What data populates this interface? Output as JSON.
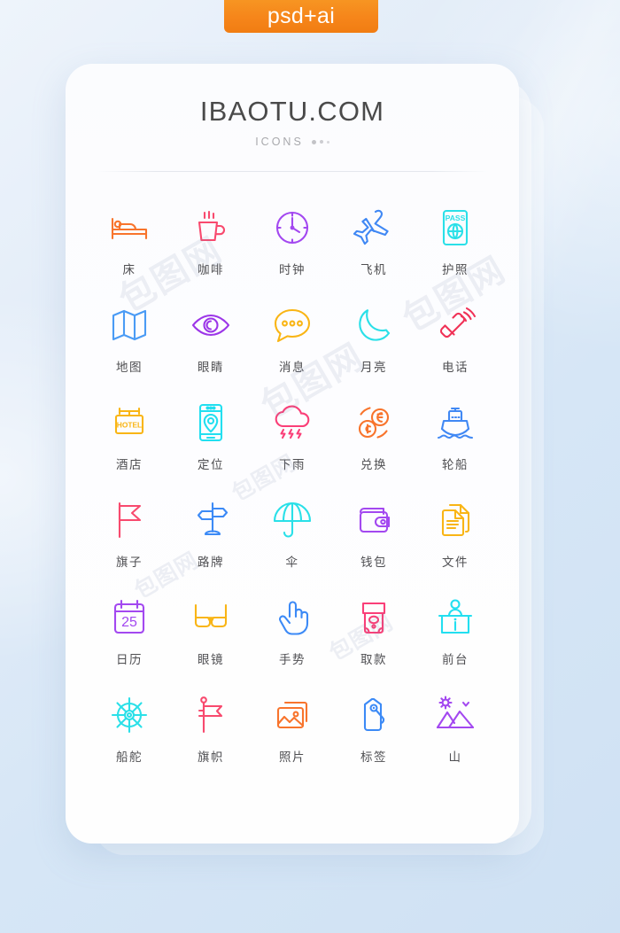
{
  "badge": {
    "label": "psd+ai",
    "color": "#f6851a"
  },
  "card": {
    "title": "IBAOTU.COM",
    "subtitle": "ICONS"
  },
  "watermark": {
    "text": "包图网"
  },
  "icons": [
    {
      "name": "bed",
      "label": "床",
      "color": "#f8742c"
    },
    {
      "name": "coffee",
      "label": "咖啡",
      "color": "#f84a6e"
    },
    {
      "name": "clock",
      "label": "时钟",
      "color": "#a348f0"
    },
    {
      "name": "airplane",
      "label": "飞机",
      "color": "#4088f4"
    },
    {
      "name": "passport",
      "label": "护照",
      "color": "#2ae0e8"
    },
    {
      "name": "map",
      "label": "地图",
      "color": "#4a9bf5"
    },
    {
      "name": "eye",
      "label": "眼睛",
      "color": "#9c36e8"
    },
    {
      "name": "message",
      "label": "消息",
      "color": "#f9b515"
    },
    {
      "name": "moon",
      "label": "月亮",
      "color": "#2ae0e8"
    },
    {
      "name": "phone",
      "label": "电话",
      "color": "#f03257"
    },
    {
      "name": "hotel",
      "label": "酒店",
      "color": "#f9b515"
    },
    {
      "name": "location",
      "label": "定位",
      "color": "#22dff0"
    },
    {
      "name": "rain",
      "label": "下雨",
      "color": "#fa3f78"
    },
    {
      "name": "exchange",
      "label": "兑换",
      "color": "#f8742c"
    },
    {
      "name": "ship",
      "label": "轮船",
      "color": "#4088f4"
    },
    {
      "name": "flag",
      "label": "旗子",
      "color": "#f84a6e"
    },
    {
      "name": "road-sign",
      "label": "路牌",
      "color": "#3c8af6"
    },
    {
      "name": "umbrella",
      "label": "伞",
      "color": "#2ae0e8"
    },
    {
      "name": "wallet",
      "label": "钱包",
      "color": "#a348f0"
    },
    {
      "name": "documents",
      "label": "文件",
      "color": "#f9b515"
    },
    {
      "name": "calendar",
      "label": "日历",
      "color": "#a348f0",
      "text": "25"
    },
    {
      "name": "glasses",
      "label": "眼镜",
      "color": "#f9b515"
    },
    {
      "name": "gesture",
      "label": "手势",
      "color": "#3c8af6"
    },
    {
      "name": "atm",
      "label": "取款",
      "color": "#fa3f78"
    },
    {
      "name": "reception",
      "label": "前台",
      "color": "#22dff0",
      "text": "i"
    },
    {
      "name": "ship-wheel",
      "label": "船舵",
      "color": "#2ae0e8"
    },
    {
      "name": "banner",
      "label": "旗帜",
      "color": "#f84a6e"
    },
    {
      "name": "photo",
      "label": "照片",
      "color": "#f8742c"
    },
    {
      "name": "tag",
      "label": "标签",
      "color": "#3c8af6"
    },
    {
      "name": "mountain",
      "label": "山",
      "color": "#a348f0"
    }
  ],
  "icon_texts": {
    "passport": "PASS",
    "hotel": "HOTEL",
    "calendar": "25",
    "reception": "i"
  }
}
